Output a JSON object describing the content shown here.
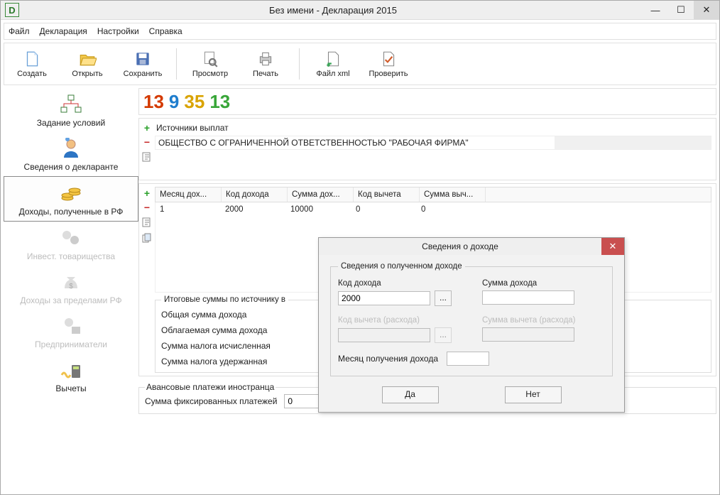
{
  "window": {
    "title": "Без имени - Декларация 2015",
    "app_icon_letter": "D"
  },
  "menu": [
    "Файл",
    "Декларация",
    "Настройки",
    "Справка"
  ],
  "toolbar": {
    "create": "Создать",
    "open": "Открыть",
    "save": "Сохранить",
    "preview": "Просмотр",
    "print": "Печать",
    "file_xml": "Файл xml",
    "check": "Проверить"
  },
  "nav": {
    "conditions": "Задание условий",
    "declarant": "Сведения о декларанте",
    "income_rf": "Доходы, полученные в РФ",
    "invest": "Инвест. товарищества",
    "foreign": "Доходы за пределами РФ",
    "entrepreneur": "Предприниматели",
    "deductions": "Вычеты"
  },
  "tabs": {
    "n1": "13",
    "n2": "9",
    "n3": "35",
    "n4": "13"
  },
  "sources": {
    "title": "Источники выплат",
    "row1": "ОБЩЕСТВО С ОГРАНИЧЕННОЙ ОТВЕТСТВЕННОСТЬЮ \"РАБОЧАЯ ФИРМА\""
  },
  "table": {
    "headers": {
      "c1": "Месяц дох...",
      "c2": "Код дохода",
      "c3": "Сумма дох...",
      "c4": "Код вычета",
      "c5": "Сумма выч..."
    },
    "rows": [
      {
        "c1": "1",
        "c2": "2000",
        "c3": "10000",
        "c4": "0",
        "c5": "0"
      }
    ]
  },
  "totals": {
    "legend": "Итоговые суммы по источнику в",
    "r1": "Общая сумма дохода",
    "r2": "Облагаемая сумма дохода",
    "r3": "Сумма налога исчисленная",
    "r4": "Сумма налога удержанная"
  },
  "advance": {
    "legend": "Авансовые платежи иностранца",
    "label": "Сумма фиксированных платежей",
    "value": "0"
  },
  "modal": {
    "title": "Сведения о доходе",
    "group": "Сведения о полученном доходе",
    "income_code": "Код дохода",
    "income_code_val": "2000",
    "income_sum": "Сумма дохода",
    "income_sum_val": "",
    "deduct_code": "Код вычета (расхода)",
    "deduct_sum": "Сумма вычета (расхода)",
    "month": "Месяц получения дохода",
    "month_val": "",
    "yes": "Да",
    "no": "Нет"
  }
}
